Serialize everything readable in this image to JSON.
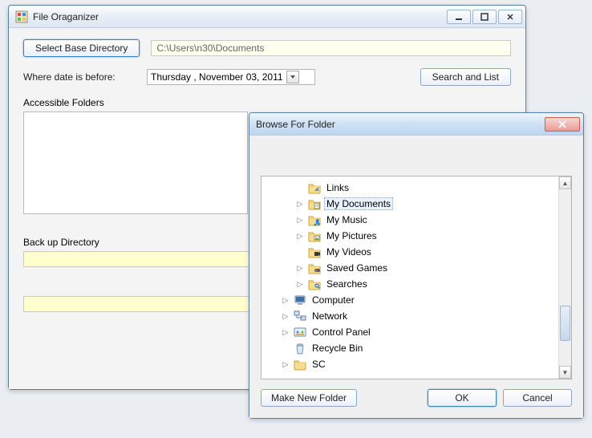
{
  "main": {
    "title": "File Oraganizer",
    "select_dir_btn": "Select Base Directory",
    "base_path": "C:\\Users\\n30\\Documents",
    "date_label": "Where date is before:",
    "date_value": "Thursday  , November 03, 2011",
    "search_btn": "Search and List",
    "accessible_label": "Accessible Folders",
    "backup_label": "Back up Directory"
  },
  "browse": {
    "title": "Browse For Folder",
    "make_btn": "Make New Folder",
    "ok_btn": "OK",
    "cancel_btn": "Cancel",
    "tree": [
      {
        "label": "Links",
        "icon": "folder-link",
        "indent": 2,
        "expander": "none",
        "selected": false
      },
      {
        "label": "My Documents",
        "icon": "folder-doc",
        "indent": 2,
        "expander": "right",
        "selected": true
      },
      {
        "label": "My Music",
        "icon": "folder-music",
        "indent": 2,
        "expander": "right",
        "selected": false
      },
      {
        "label": "My Pictures",
        "icon": "folder-pic",
        "indent": 2,
        "expander": "right",
        "selected": false
      },
      {
        "label": "My Videos",
        "icon": "folder-video",
        "indent": 2,
        "expander": "none",
        "selected": false
      },
      {
        "label": "Saved Games",
        "icon": "folder-game",
        "indent": 2,
        "expander": "right",
        "selected": false
      },
      {
        "label": "Searches",
        "icon": "folder-search",
        "indent": 2,
        "expander": "right",
        "selected": false
      },
      {
        "label": "Computer",
        "icon": "computer",
        "indent": 1,
        "expander": "right",
        "selected": false
      },
      {
        "label": "Network",
        "icon": "network",
        "indent": 1,
        "expander": "right",
        "selected": false
      },
      {
        "label": "Control Panel",
        "icon": "control",
        "indent": 1,
        "expander": "right",
        "selected": false
      },
      {
        "label": "Recycle Bin",
        "icon": "recycle",
        "indent": 1,
        "expander": "none",
        "selected": false
      },
      {
        "label": "SC",
        "icon": "folder",
        "indent": 1,
        "expander": "right",
        "selected": false
      }
    ]
  }
}
